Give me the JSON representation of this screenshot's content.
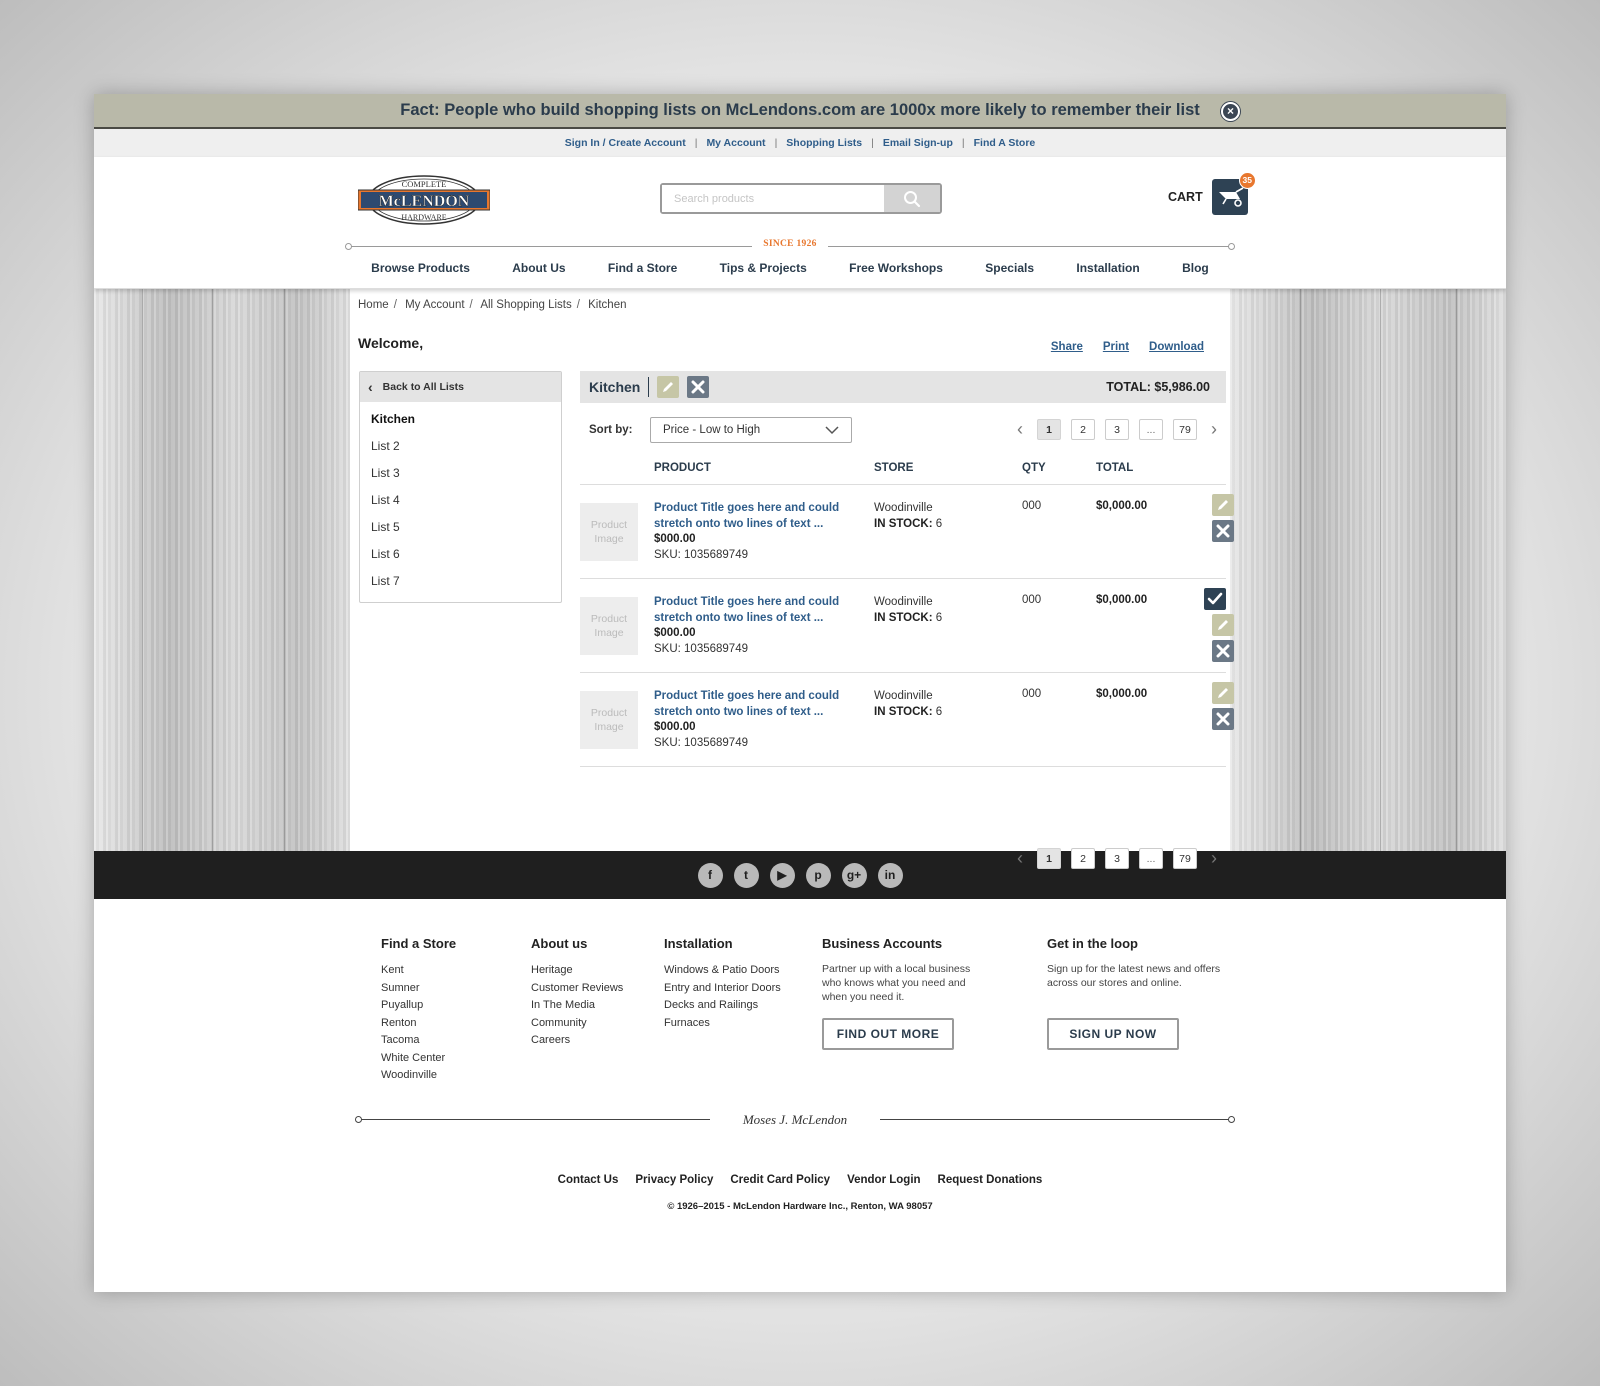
{
  "fact_bar": {
    "text": "Fact: People who build shopping lists on McLendons.com are 1000x more likely to remember their list",
    "close_icon": "close-circle-icon"
  },
  "utility_nav": [
    "Sign In / Create Account",
    "My Account",
    "Shopping Lists",
    "Email Sign-up",
    "Find A Store"
  ],
  "header": {
    "logo": {
      "top_text": "COMPLETE",
      "main_text": "McLENDON",
      "bottom_text": "HARDWARE"
    },
    "search_placeholder": "Search products",
    "search_icon": "search-icon",
    "cart_label": "CART",
    "cart_count": "35",
    "cart_icon": "wheelbarrow-icon",
    "since_text": "SINCE 1926"
  },
  "main_nav": [
    "Browse Products",
    "About Us",
    "Find a Store",
    "Tips & Projects",
    "Free Workshops",
    "Specials",
    "Installation",
    "Blog"
  ],
  "breadcrumb": [
    "Home",
    "My Account",
    "All Shopping Lists",
    "Kitchen"
  ],
  "welcome": "Welcome,",
  "page_actions": [
    "Share",
    "Print",
    "Download"
  ],
  "sidebar": {
    "back_label": "Back to All Lists",
    "lists": [
      "Kitchen",
      "List 2",
      "List 3",
      "List 4",
      "List 5",
      "List 6",
      "List 7"
    ],
    "active_index": 0
  },
  "list": {
    "title": "Kitchen",
    "total_label": "TOTAL: $5,986.00",
    "sort_label": "Sort by:",
    "sort_value": "Price - Low to High",
    "pagination": {
      "pages": [
        "1",
        "2",
        "3",
        "...",
        "79"
      ],
      "active": "1"
    },
    "columns": {
      "product": "PRODUCT",
      "store": "STORE",
      "qty": "QTY",
      "total": "TOTAL"
    },
    "items": [
      {
        "image_label": "Product Image",
        "title": "Product Title goes here and could stretch onto two lines of text ...",
        "price": "$000.00",
        "sku": "SKU: 1035689749",
        "store": "Woodinville",
        "stock_label": "IN STOCK:",
        "stock": "6",
        "qty": "000",
        "total": "$0,000.00",
        "status_icon": "add-to-cart-icon"
      },
      {
        "image_label": "Product Image",
        "title": "Product Title goes here and could stretch onto two lines of text ...",
        "price": "$000.00",
        "sku": "SKU: 1035689749",
        "store": "Woodinville",
        "stock_label": "IN STOCK:",
        "stock": "6",
        "qty": "000",
        "total": "$0,000.00",
        "status_icon": "checkmark-icon"
      },
      {
        "image_label": "Product Image",
        "title": "Product Title goes here and could stretch onto two lines of text ...",
        "price": "$000.00",
        "sku": "SKU: 1035689749",
        "store": "Woodinville",
        "stock_label": "IN STOCK:",
        "stock": "6",
        "qty": "000",
        "total": "$0,000.00",
        "status_icon": "add-to-cart-icon"
      }
    ]
  },
  "social": [
    "facebook-icon",
    "twitter-icon",
    "youtube-icon",
    "pinterest-icon",
    "google-plus-icon",
    "linkedin-icon"
  ],
  "footer": {
    "find_store": {
      "heading": "Find a Store",
      "items": [
        "Kent",
        "Sumner",
        "Puyallup",
        "Renton",
        "Tacoma",
        "White Center",
        "Woodinville"
      ]
    },
    "about": {
      "heading": "About us",
      "items": [
        "Heritage",
        "Customer Reviews",
        "In The Media",
        "Community",
        "Careers"
      ]
    },
    "installation": {
      "heading": "Installation",
      "items": [
        "Windows & Patio Doors",
        "Entry and Interior Doors",
        "Decks and Railings",
        "Furnaces"
      ]
    },
    "business": {
      "heading": "Business Accounts",
      "text": "Partner up with a local business who knows what you need and when you need it.",
      "button": "FIND OUT MORE"
    },
    "loop": {
      "heading": "Get in the loop",
      "text": "Sign up for the latest news and offers across our stores and online.",
      "button": "SIGN UP NOW"
    },
    "signature": "Moses J. McLendon",
    "links": [
      "Contact Us",
      "Privacy Policy",
      "Credit Card Policy",
      "Vendor Login",
      "Request Donations"
    ],
    "copyright": "© 1926–2015 - McLendon Hardware Inc., Renton, WA 98057"
  },
  "colors": {
    "navy": "#2b3c4c",
    "link_blue": "#2f5d8a",
    "orange": "#e8772e",
    "khaki": "#b9b9a9"
  }
}
